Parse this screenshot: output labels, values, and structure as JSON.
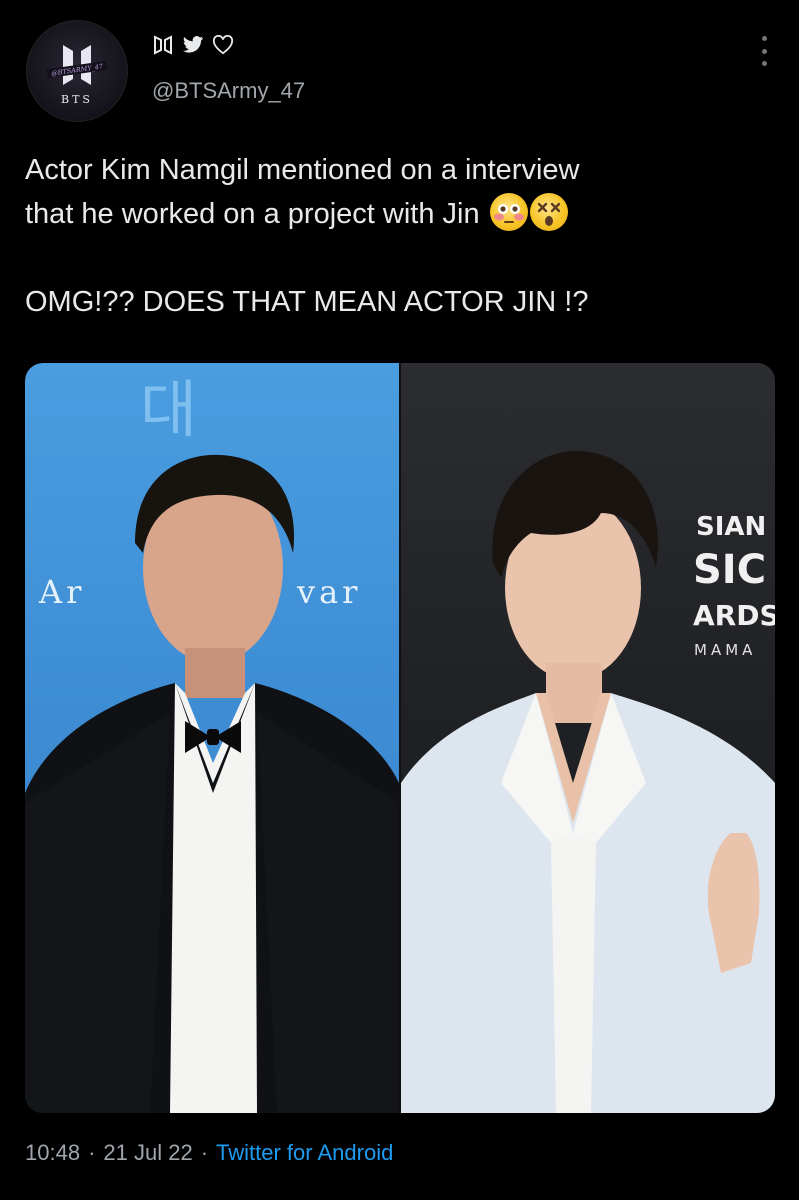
{
  "header": {
    "avatar_text_top": "@BTSARMY_47",
    "avatar_text_bottom": "BTS",
    "display_name_icons": [
      "bts-logo-icon",
      "twitter-bird-icon",
      "heart-icon"
    ],
    "handle": "@BTSArmy_47",
    "more_icon": "more-vertical-icon"
  },
  "tweet": {
    "line1": "Actor Kim Namgil mentioned on a interview",
    "line2": "that he worked on a project with Jin",
    "emojis": [
      "flushed-face-emoji",
      "dizzy-face-emoji"
    ],
    "line3": "OMG!?? DOES THAT MEAN ACTOR JIN !?"
  },
  "photo": {
    "left_sign_text_top": "대",
    "left_sign_text_mid_left": "Ar",
    "left_sign_text_mid_right": "var",
    "right_sign_lines": [
      "SIAN",
      "SIC",
      "ARDS",
      "MAMA"
    ],
    "colors": {
      "left_bg": "#3f8fd6",
      "right_bg": "#1e2024"
    }
  },
  "meta": {
    "time": "10:48",
    "sep1": "·",
    "date": "21 Jul 22",
    "sep2": "·",
    "source": "Twitter for Android",
    "source_color": "#1d9bf0"
  }
}
